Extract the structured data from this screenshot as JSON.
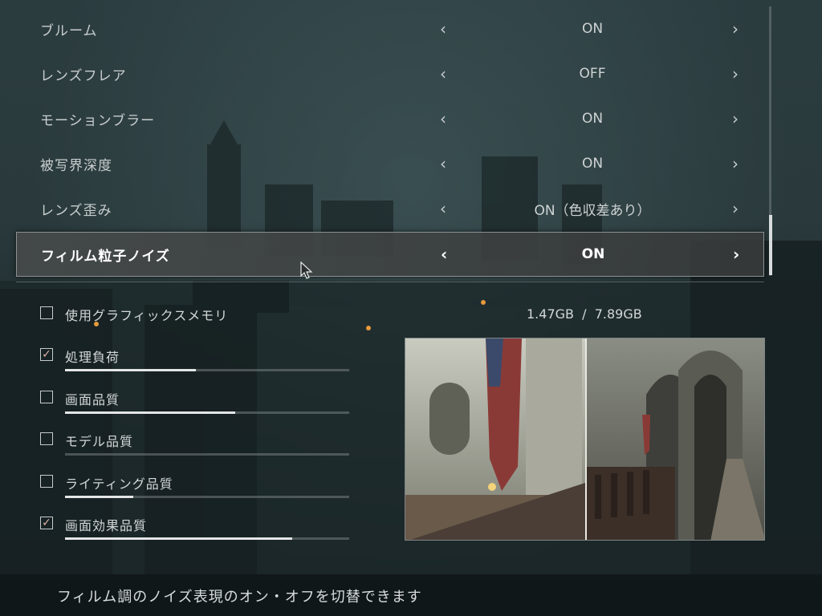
{
  "settings": [
    {
      "label": "ブルーム",
      "value": "ON"
    },
    {
      "label": "レンズフレア",
      "value": "OFF"
    },
    {
      "label": "モーションブラー",
      "value": "ON"
    },
    {
      "label": "被写界深度",
      "value": "ON"
    },
    {
      "label": "レンズ歪み",
      "value": "ON（色収差あり）"
    },
    {
      "label": "フィルム粒子ノイズ",
      "value": "ON",
      "selected": true
    }
  ],
  "arrows": {
    "left": "‹",
    "right": "›"
  },
  "memory": {
    "label": "使用グラフィックスメモリ",
    "used": "1.47GB",
    "separator": "/",
    "total": "7.89GB",
    "display": "1.47GB  /  7.89GB"
  },
  "load_items": [
    {
      "label": "処理負荷",
      "checked": true,
      "level": 0.46
    },
    {
      "label": "画面品質",
      "checked": false,
      "level": 0.6
    },
    {
      "label": "モデル品質",
      "checked": false,
      "level": 0.0
    },
    {
      "label": "ライティング品質",
      "checked": false,
      "level": 0.24
    },
    {
      "label": "画面効果品質",
      "checked": true,
      "level": 0.8
    }
  ],
  "check_mark": "✓",
  "hint": "フィルム調のノイズ表現のオン・オフを切替できます",
  "colors": {
    "selected_bg": "#474b4b",
    "check": "#e0b0a8"
  }
}
